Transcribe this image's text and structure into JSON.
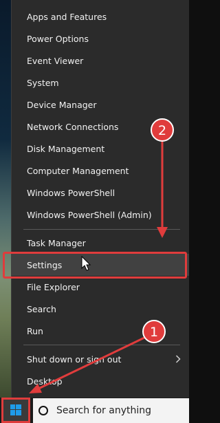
{
  "menu": {
    "items": [
      {
        "label": "Apps and Features"
      },
      {
        "label": "Power Options"
      },
      {
        "label": "Event Viewer"
      },
      {
        "label": "System"
      },
      {
        "label": "Device Manager"
      },
      {
        "label": "Network Connections"
      },
      {
        "label": "Disk Management"
      },
      {
        "label": "Computer Management"
      },
      {
        "label": "Windows PowerShell"
      },
      {
        "label": "Windows PowerShell (Admin)"
      },
      {
        "label": "Task Manager"
      },
      {
        "label": "Settings"
      },
      {
        "label": "File Explorer"
      },
      {
        "label": "Search"
      },
      {
        "label": "Run"
      },
      {
        "label": "Shut down or sign out"
      },
      {
        "label": "Desktop"
      }
    ],
    "hovered_item": "Settings"
  },
  "taskbar": {
    "start_icon": "windows-logo-icon",
    "search_placeholder": "Search for anything",
    "search_icon": "search-circle-icon"
  },
  "annotations": {
    "step_1": "1",
    "step_2": "2",
    "annotation_color": "#e03c3c"
  }
}
